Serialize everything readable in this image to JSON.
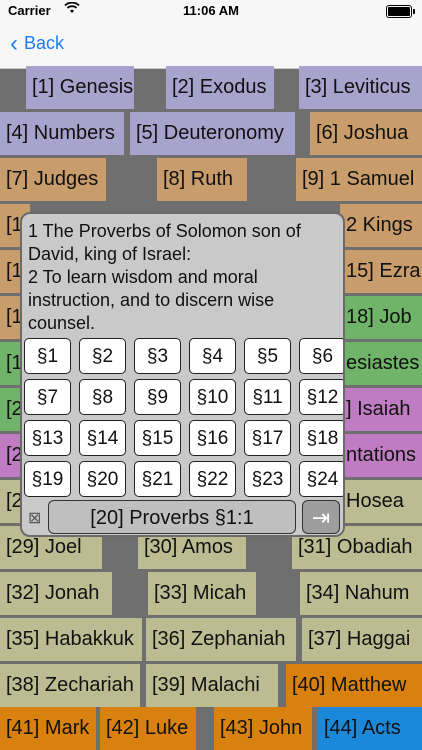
{
  "status_bar": {
    "carrier": "Carrier",
    "time": "11:06 AM"
  },
  "nav": {
    "back_label": "Back"
  },
  "books": [
    "[1] Genesis",
    "[2] Exodus",
    "[3] Leviticus",
    "[4] Numbers",
    "[5] Deuteronomy",
    "[6] Joshua",
    "[7] Judges",
    "[8] Ruth",
    "[9] 1 Samuel",
    "[10] 1 Samuel",
    "2 Kings",
    "[13]",
    "15] Ezra",
    "[16]",
    "18] Job",
    "[19]",
    "esiastes",
    "[2",
    "] Isaiah",
    "[2",
    "ntations",
    "[2",
    "Hosea",
    "[29] Joel",
    "[30] Amos",
    "[31] Obadiah",
    "[32] Jonah",
    "[33] Micah",
    "[34] Nahum",
    "[35] Habakkuk",
    "[36] Zephaniah",
    "[37] Haggai",
    "[38] Zechariah",
    "[39] Malachi",
    "[40] Matthew",
    "[41] Mark",
    "[42] Luke",
    "[43] John",
    "[44] Acts"
  ],
  "popup": {
    "verse_lines": [
      "1 The Proverbs of Solomon son of",
      "David, king of Israel:",
      "2 To learn wisdom and moral",
      "instruction, and to discern wise",
      "counsel."
    ],
    "sections": [
      "§1",
      "§2",
      "§3",
      "§4",
      "§5",
      "§6",
      "§7",
      "§8",
      "§9",
      "§10",
      "§11",
      "§12",
      "§13",
      "§14",
      "§15",
      "§16",
      "§17",
      "§18",
      "§19",
      "§20",
      "§21",
      "§22",
      "§23",
      "§24"
    ],
    "current_label": "[20] Proverbs §1:1",
    "clear_icon": "⊠",
    "go_icon": "⇥"
  }
}
